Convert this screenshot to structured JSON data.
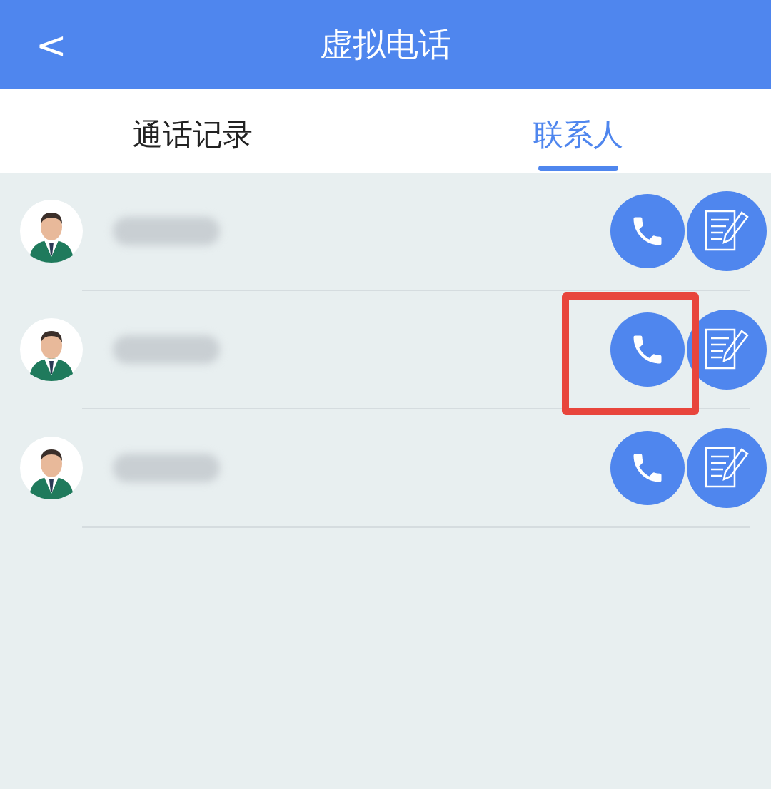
{
  "header": {
    "back": "<",
    "title": "虚拟电话"
  },
  "tabs": [
    {
      "label": "通话记录",
      "selected": false
    },
    {
      "label": "联系人",
      "selected": true
    }
  ],
  "contacts": [
    {
      "highlighted": false
    },
    {
      "highlighted": true
    },
    {
      "highlighted": false
    }
  ]
}
